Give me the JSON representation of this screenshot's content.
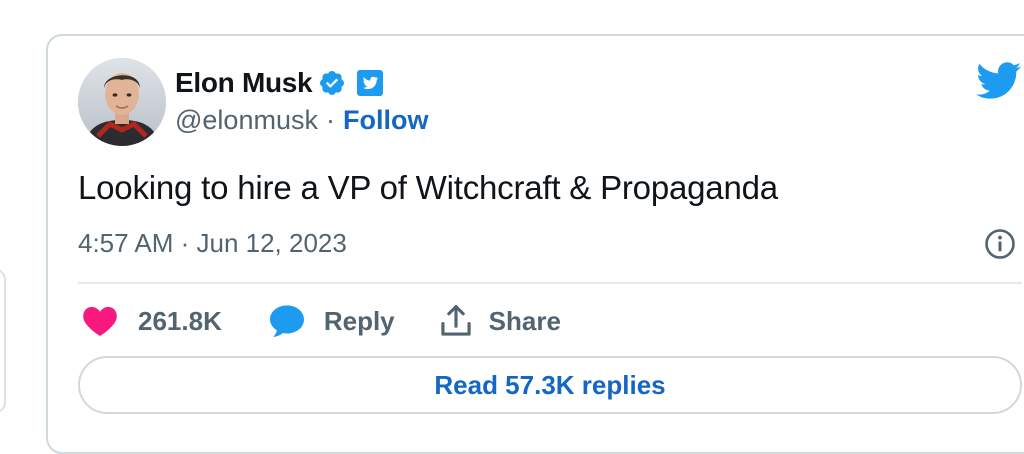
{
  "tweet": {
    "author": {
      "display_name": "Elon Musk",
      "handle": "@elonmusk",
      "separator": "·",
      "follow_label": "Follow",
      "verified_icon": "verified-badge-icon",
      "avatar": "profile-photo"
    },
    "text": "Looking to hire a VP of Witchcraft & Propaganda",
    "timestamp": "4:57 AM · Jun 12, 2023",
    "actions": {
      "likes": "261.8K",
      "reply_label": "Reply",
      "share_label": "Share"
    },
    "read_replies_label": "Read 57.3K replies"
  },
  "colors": {
    "accent": "#1467c2",
    "twitter_blue": "#1d9bf0",
    "heart": "#f91880",
    "muted_text": "#536471",
    "border": "#cfd9de"
  },
  "icons": {
    "brand": "twitter-bird-icon",
    "info": "info-icon",
    "like": "heart-icon",
    "reply": "speech-bubble-icon",
    "share": "share-upload-icon"
  }
}
